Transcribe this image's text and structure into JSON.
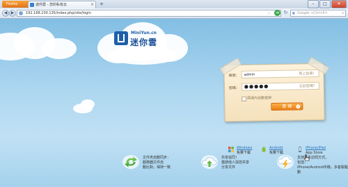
{
  "browser": {
    "menu_button": "Firefox",
    "tab_title": "迷你雲 - 您的私有云",
    "new_tab": "+",
    "url": "192.168.230.135/index.php/site/login",
    "search_placeholder": "Google <Ctrl+K>",
    "search_engine_letter": "g",
    "win_minimize": "–",
    "win_maximize": "□",
    "win_close": "✕"
  },
  "logo": {
    "en": "MiniYun.cn",
    "cn": "迷你雲"
  },
  "login": {
    "account_label": "帳號：",
    "account_value": "admin",
    "account_hint": "馬上註冊！",
    "password_label": "密碼：",
    "password_dots": "●●●●●",
    "password_hint": "忘記密碼？",
    "remember_label": "兩週內自動登錄",
    "submit_label": "登 錄"
  },
  "downloads": [
    {
      "name": "Windows",
      "action": "免費下載"
    },
    {
      "name": "Android",
      "action": "免費下載"
    },
    {
      "name": "iPhone/iPad",
      "action": "App Store"
    }
  ],
  "features": [
    {
      "line1": "文件夾自動同步：",
      "line2": "服務器文件自",
      "line3": "動比對，保持一致"
    },
    {
      "line1": "共享協同！",
      "line2": "邀請他人與您共享",
      "line3": "分享文件"
    },
    {
      "line1": "支持更多訪問方式，",
      "line2": "包括：",
      "line3": "iPhone/Android手機，多客製驅動"
    }
  ],
  "colors": {
    "sky": "#8fc3e4",
    "brand_blue": "#1f5fa8",
    "login_orange": "#ec7d13",
    "card_paper": "#fbeccc"
  }
}
